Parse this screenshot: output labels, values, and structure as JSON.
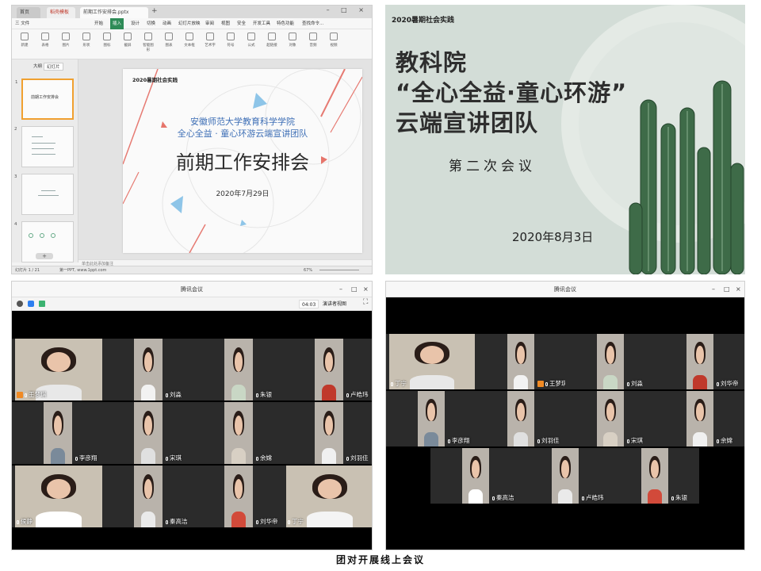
{
  "wps": {
    "tabs": [
      "首页",
      "稻壳模板",
      "前期工作安排会.pptx"
    ],
    "menu": [
      "三 文件",
      "开始",
      "插入",
      "设计",
      "切换",
      "动画",
      "幻灯片放映",
      "审阅",
      "视图",
      "安全",
      "开发工具",
      "特色功能",
      "查找命令..."
    ],
    "ribbon": [
      "新建",
      "表格",
      "图片",
      "形状",
      "图标",
      "截屏",
      "智能图形",
      "图表",
      "文本框",
      "艺术字",
      "符号",
      "公式",
      "超链接",
      "对象",
      "音频",
      "视频"
    ],
    "side_tabs": [
      "大纲",
      "幻灯片"
    ],
    "thumb_text": "前期工作安排会",
    "slide": {
      "tag": "2020暑期社会实践",
      "school": "安徽师范大学教育科学学院",
      "team": "全心全益 · 童心环游云端宣讲团队",
      "title": "前期工作安排会",
      "date": "2020年7月29日"
    },
    "notes": "单击此处添加备注",
    "status": {
      "page": "幻灯片 1 / 21",
      "theme": "第一PPT, www.1ppt.com",
      "zoom": "67%"
    }
  },
  "slide2": {
    "tag": "2020暑期社会实践",
    "lines": [
      "教科院",
      "“全心全益·童心环游”",
      "云端宣讲团队"
    ],
    "subtitle": "第二次会议",
    "date": "2020年8月3日"
  },
  "meeting1": {
    "title": "腾讯会议",
    "timer": "04:03",
    "view_label": "演讲者视图",
    "participants": [
      "王梦琪",
      "刘淼",
      "朱银",
      "卢皓玮",
      "李彦翔",
      "宋琪",
      "余嫦",
      "刘羽佳",
      "侯静",
      "秦高洁",
      "刘华帝",
      "丁宁"
    ]
  },
  "meeting2": {
    "title": "腾讯会议",
    "participants": [
      "丁宁",
      "王梦琪",
      "刘淼",
      "刘华帝",
      "李彦翔",
      "刘羽佳",
      "宋琪",
      "余嫦",
      "秦高洁",
      "卢皓玮",
      "朱银"
    ]
  },
  "caption": "团对开展线上会议",
  "colors": {
    "wps_green": "#2e8b57",
    "host_orange": "#f08a24",
    "slide_sage": "#d3ddd7",
    "slide_blue": "#3e6fb6"
  }
}
